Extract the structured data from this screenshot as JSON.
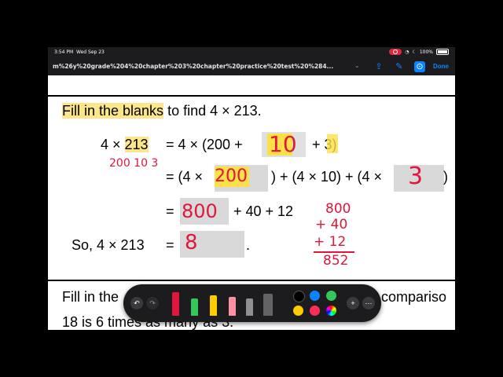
{
  "status": {
    "time": "3:54 PM",
    "date": "Wed Sep 23",
    "battery": "100%"
  },
  "toolbar": {
    "url": "m%26y%20grade%204%20chapter%203%20chapter%20practice%20test%20%284...",
    "chevron": "⌄",
    "done_label": "Done"
  },
  "worksheet": {
    "q1_prefix": "Fill in the blanks",
    "q1_suffix": " to find 4 × 213.",
    "row1_left": "4 × ",
    "row1_left_hl": "213",
    "row1_eq": "= 4 × (200 + ",
    "row1_tail": "+ 3)",
    "row2_a": "= (4 × ",
    "row2_b": ") + (4 × 10) + (4 × ",
    "row2_c": ")",
    "row3_eq": "=",
    "row3_tail": "+ 40 + 12",
    "row4_so": "So, 4 × 213",
    "row4_eq": "=",
    "row4_dot": ".",
    "q2_line1_start": "Fill in the",
    "q2_line1_end": "compariso",
    "q2_line2": "18 is 6 times as many as 3."
  },
  "handwriting": {
    "blank1": "10",
    "blank2": "200",
    "blank3": "3",
    "blank4": "800",
    "blank5": "8",
    "expand": "200 10  3",
    "sum_top": "800",
    "sum_mid": "+ 40",
    "sum_low": "+ 12",
    "sum_total": "852"
  },
  "markup_tools": {
    "colors": [
      "#000000",
      "#0a84ff",
      "#34c759",
      "#ffcc00",
      "#ff2d55"
    ]
  }
}
